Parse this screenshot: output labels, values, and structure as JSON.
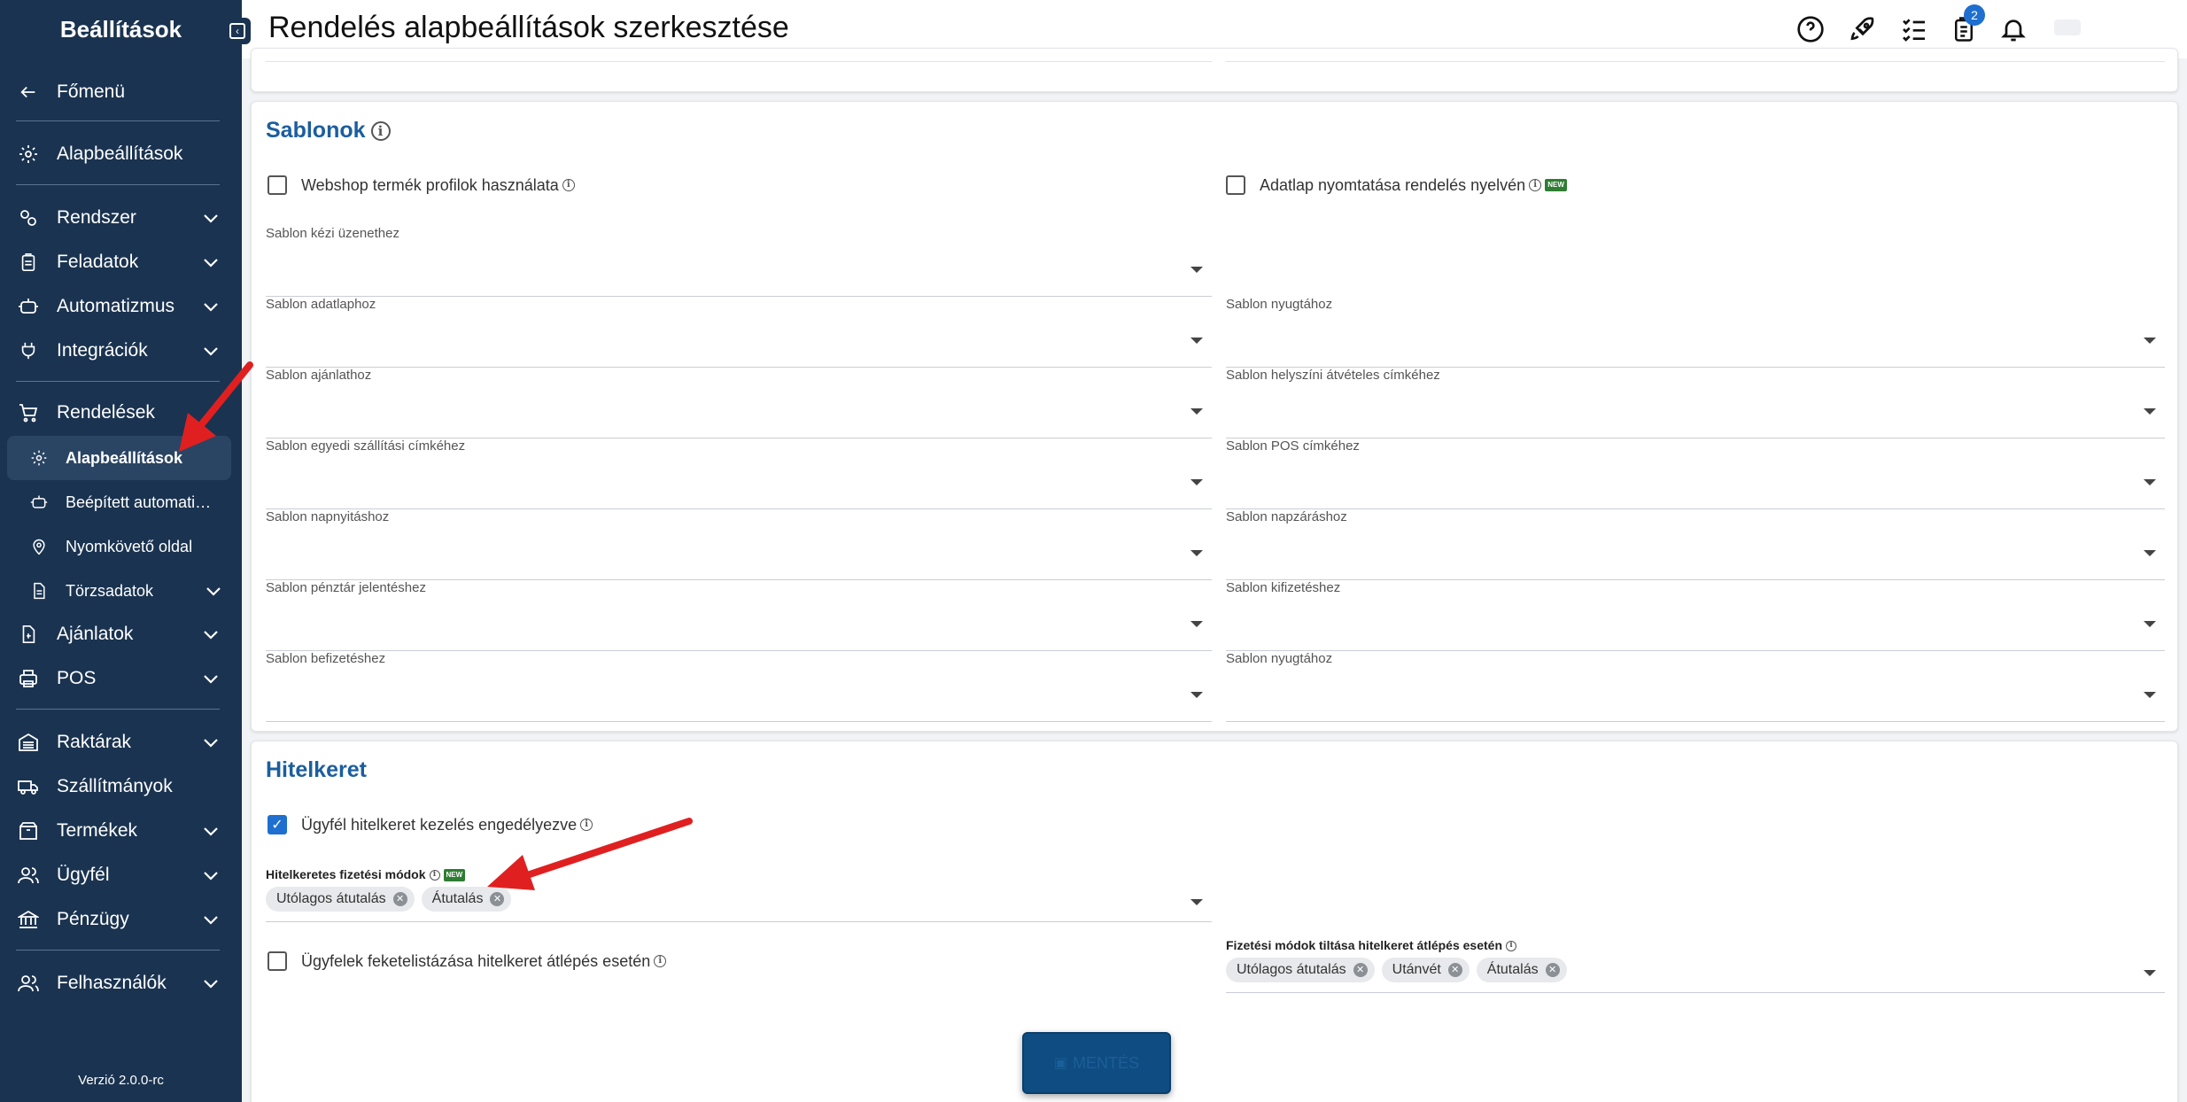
{
  "sidebar": {
    "title": "Beállítások",
    "back_label": "Főmenü",
    "items": {
      "alapbeallitasok": "Alapbeállítások",
      "rendszer": "Rendszer",
      "feladatok": "Feladatok",
      "automatizmus": "Automatizmus",
      "integraciok": "Integrációk",
      "rendelesek": "Rendelések",
      "sub_alap": "Alapbeállítások",
      "sub_beepitett": "Beépített automati…",
      "sub_nyomkoveto": "Nyomkövető oldal",
      "sub_torzsadatok": "Törzsadatok",
      "ajanlatok": "Ajánlatok",
      "pos": "POS",
      "raktarak": "Raktárak",
      "szallitmanyok": "Szállítmányok",
      "termekek": "Termékek",
      "ugyfel": "Ügyfél",
      "penzugy": "Pénzügy",
      "felhasznalok": "Felhasználók"
    },
    "version": "Verzió 2.0.0-rc"
  },
  "header": {
    "title": "Rendelés alapbeállítások szerkesztése",
    "tasks_badge": "2"
  },
  "sablonok": {
    "title": "Sablonok",
    "webshop_label": "Webshop termék profilok használata",
    "adatlap_label": "Adatlap nyomtatása rendelés nyelvén",
    "new_badge": "NEW",
    "left_fields": [
      "Sablon kézi üzenethez",
      "Sablon adatlaphoz",
      "Sablon ajánlathoz",
      "Sablon egyedi szállítási címkéhez",
      "Sablon napnyitáshoz",
      "Sablon pénztár jelentéshez",
      "Sablon befizetéshez"
    ],
    "right_fields": [
      "Sablon nyugtához",
      "Sablon helyszíni átvételes címkéhez",
      "Sablon POS címkéhez",
      "Sablon napzáráshoz",
      "Sablon kifizetéshez",
      "Sablon nyugtához"
    ]
  },
  "hitelkeret": {
    "title": "Hitelkeret",
    "enable_label": "Ügyfél hitelkeret kezelés engedélyezve",
    "methods_label": "Hitelkeretes fizetési módok",
    "methods_chips": [
      "Utólagos átutalás",
      "Átutalás"
    ],
    "blacklist_label": "Ügyfelek feketelistázása hitelkeret átlépés esetén",
    "block_label": "Fizetési módok tiltása hitelkeret átlépés esetén",
    "block_chips": [
      "Utólagos átutalás",
      "Utánvét",
      "Átutalás"
    ],
    "new_badge": "NEW"
  },
  "save_button": "MENTÉS",
  "colors": {
    "sidebar_bg": "#1a3350",
    "accent": "#1b5e9e",
    "checkbox": "#1e6fd0",
    "new_badge": "#2e7d32",
    "annotation_arrow": "#e02020"
  }
}
